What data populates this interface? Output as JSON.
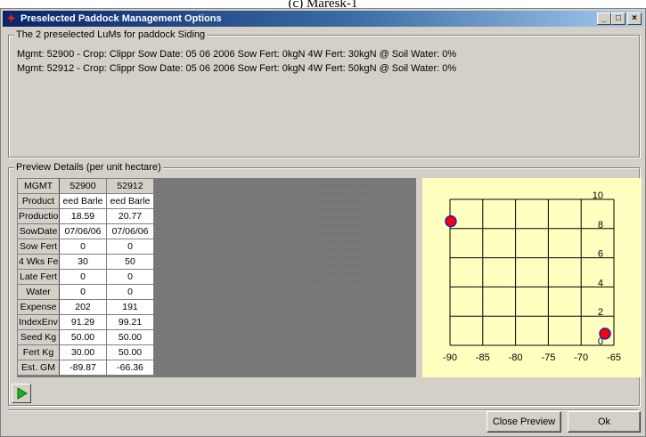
{
  "caption": "(c) Maresk-1",
  "window": {
    "title": "Preselected Paddock Management Options",
    "minimize_label": "_",
    "maximize_label": "□",
    "close_label": "×"
  },
  "lums_group": {
    "legend": "The 2 preselected LuMs for paddock Siding",
    "lines": [
      "Mgmt: 52900 - Crop: Clippr Sow Date: 05 06 2006 Sow Fert: 0kgN 4W Fert: 30kgN @ Soil Water: 0%",
      "Mgmt: 52912 - Crop: Clippr Sow Date: 05 06 2006 Sow Fert: 0kgN 4W Fert: 50kgN @ Soil Water: 0%"
    ]
  },
  "preview_group": {
    "legend": "Preview Details (per unit hectare)"
  },
  "table": {
    "header": [
      "MGMT",
      "52900",
      "52912"
    ],
    "rows": [
      [
        "Product",
        "eed Barle",
        "eed Barle"
      ],
      [
        "Productior",
        "18.59",
        "20.77"
      ],
      [
        "SowDate",
        "07/06/06",
        "07/06/06"
      ],
      [
        "Sow Fert",
        "0",
        "0"
      ],
      [
        "4 Wks Fer",
        "30",
        "50"
      ],
      [
        "Late Fert",
        "0",
        "0"
      ],
      [
        "Water",
        "0",
        "0"
      ],
      [
        "Expense",
        "202",
        "191"
      ],
      [
        "IndexEnv",
        "91.29",
        "99.21"
      ],
      [
        "Seed Kg",
        "50.00",
        "50.00"
      ],
      [
        "Fert Kg",
        "30.00",
        "50.00"
      ],
      [
        "Est. GM",
        "-89.87",
        "-66.36"
      ]
    ]
  },
  "chart_data": {
    "type": "scatter",
    "title": "",
    "xlabel": "",
    "ylabel": "",
    "xlim": [
      -90,
      -65
    ],
    "ylim": [
      0,
      10
    ],
    "x_ticks": [
      "-90",
      "-85",
      "-80",
      "-75",
      "-70",
      "-65"
    ],
    "y_ticks": [
      "10",
      "8",
      "6",
      "4",
      "2",
      "0"
    ],
    "grid": true,
    "points": [
      {
        "x": -89.87,
        "y": 8.5
      },
      {
        "x": -66.36,
        "y": 0.8
      }
    ],
    "colors": {
      "background": "#ffffc0",
      "marker_fill": "#ff0000",
      "marker_edge": "#2020c0"
    }
  },
  "buttons": {
    "play_icon": "play-icon",
    "close_preview": "Close Preview",
    "ok": "Ok"
  }
}
